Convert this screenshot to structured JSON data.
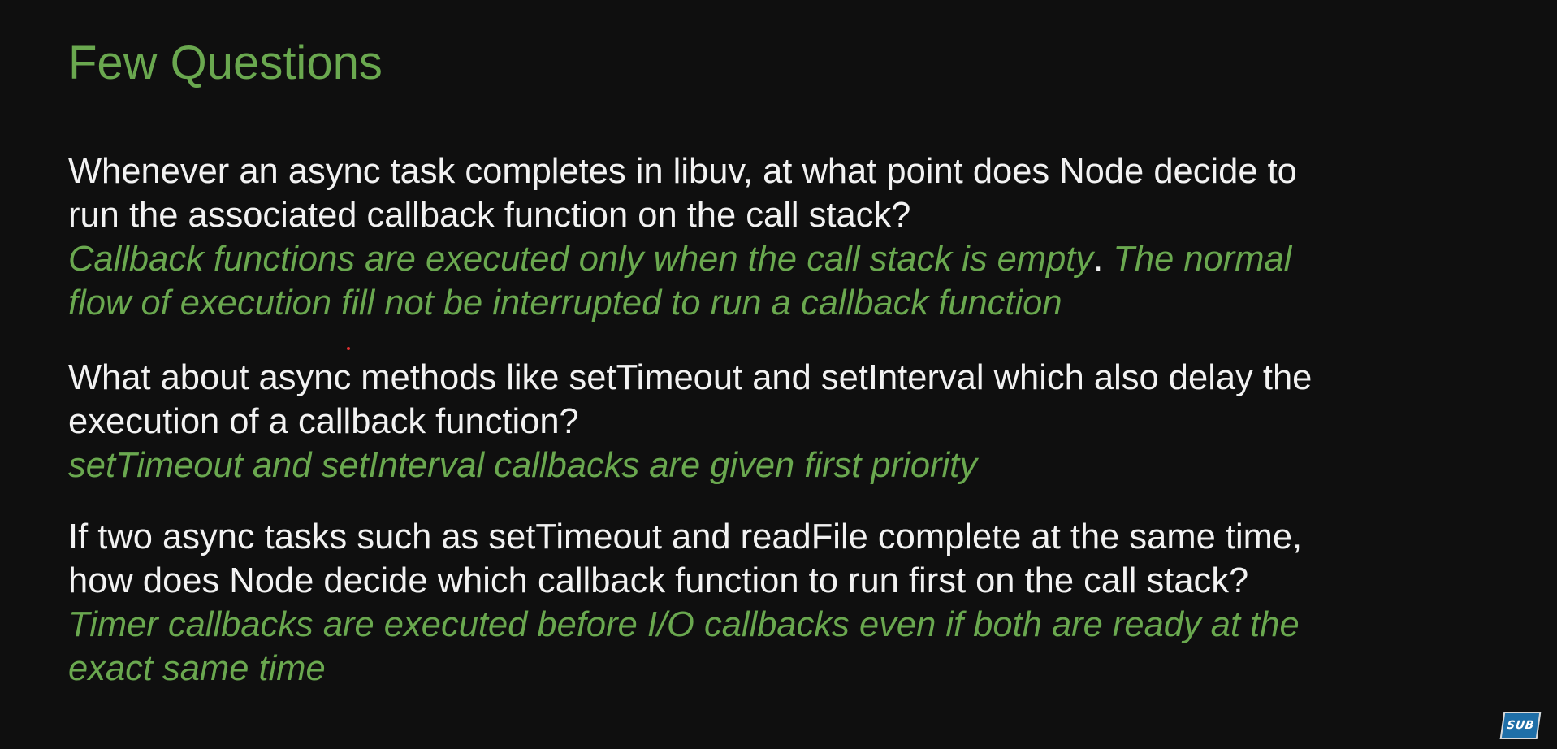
{
  "slide": {
    "title": "Few Questions",
    "items": [
      {
        "question_lines": [
          "Whenever an async task completes in libuv, at what point does Node decide to",
          "run the associated callback function on the call stack?"
        ],
        "answer_line1_italic": "Callback functions are executed only when the call stack is empty",
        "answer_line1_plain": ".",
        "answer_line1_italic2": " The normal",
        "answer_line2": "flow of execution fill not be interrupted to run a callback function"
      },
      {
        "question_lines": [
          "What about async methods like setTimeout and setInterval which also delay the",
          "execution of a callback function?"
        ],
        "answer_lines": [
          "setTimeout and setInterval callbacks are given first priority"
        ]
      },
      {
        "question_lines": [
          "If two async tasks such as setTimeout and readFile complete at the same time,",
          "how does Node decide which callback function to run first on the call stack?"
        ],
        "answer_lines": [
          "Timer callbacks are executed before I/O callbacks even if both are ready at the",
          "exact same time"
        ]
      }
    ]
  },
  "badge": {
    "label": "SUB",
    "color": "#1f6fa8"
  },
  "colors": {
    "background": "#0f0f0f",
    "title": "#6aa84f",
    "question": "#f2f2f2",
    "answer": "#6aa84f",
    "laser_pointer": "#e03030"
  }
}
